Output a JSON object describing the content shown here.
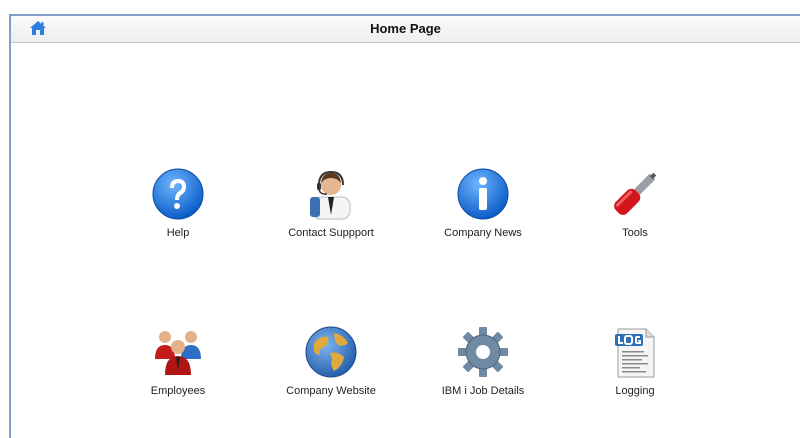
{
  "header": {
    "title": "Home Page",
    "home_icon": "home-icon"
  },
  "tiles": [
    {
      "label": "Help",
      "icon": "help-icon"
    },
    {
      "label": "Contact Suppport",
      "icon": "support-agent-icon"
    },
    {
      "label": "Company News",
      "icon": "info-icon"
    },
    {
      "label": "Tools",
      "icon": "screwdriver-icon"
    },
    {
      "label": "Employees",
      "icon": "employees-icon"
    },
    {
      "label": "Company Website",
      "icon": "globe-icon"
    },
    {
      "label": "IBM i Job Details",
      "icon": "gear-icon"
    },
    {
      "label": "Logging",
      "icon": "log-file-icon"
    }
  ]
}
